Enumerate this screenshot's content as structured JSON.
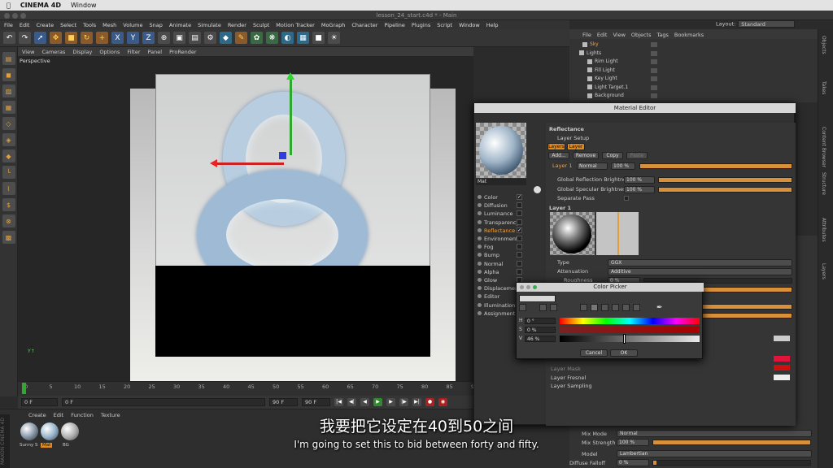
{
  "mac_menu": {
    "app": "CINEMA 4D",
    "window": "Window"
  },
  "window_title": "lesson_24_start.c4d * - Main",
  "main_menu": [
    "File",
    "Edit",
    "Create",
    "Select",
    "Tools",
    "Mesh",
    "Volume",
    "Snap",
    "Animate",
    "Simulate",
    "Render",
    "Sculpt",
    "Motion Tracker",
    "MoGraph",
    "Character",
    "Pipeline",
    "Plugins",
    "Script",
    "Window",
    "Help"
  ],
  "layout": {
    "label": "Layout:",
    "value": "Standard"
  },
  "viewport": {
    "menu": [
      "View",
      "Cameras",
      "Display",
      "Options",
      "Filter",
      "Panel",
      "ProRender"
    ],
    "label": "Perspective"
  },
  "timeline": {
    "ticks": [
      "0",
      "5",
      "10",
      "15",
      "20",
      "25",
      "30",
      "35",
      "40",
      "45",
      "50",
      "55",
      "60",
      "65",
      "70",
      "75",
      "80",
      "85",
      "90"
    ],
    "end_label": "0 F"
  },
  "frame": {
    "current": "0 F",
    "start": "0 F",
    "end": "90 F",
    "end2": "90 F"
  },
  "material_manager": {
    "menu": [
      "Create",
      "Edit",
      "Function",
      "Texture"
    ],
    "materials": [
      "Sunny S",
      "Mat",
      "BG"
    ]
  },
  "object_manager": {
    "menu": [
      "File",
      "Edit",
      "View",
      "Objects",
      "Tags",
      "Bookmarks"
    ],
    "objects": [
      "Sky",
      "Lights",
      "Rim Light",
      "Fill Light",
      "Key Light",
      "Light Target.1",
      "Background"
    ]
  },
  "right_tabs": [
    "Objects",
    "Takes",
    "Content Browser",
    "Structure",
    "Attributes",
    "Layers"
  ],
  "material_editor": {
    "title": "Material Editor",
    "mat_name": "Mat",
    "channels": [
      {
        "name": "Color",
        "checked": "✓"
      },
      {
        "name": "Diffusion",
        "checked": ""
      },
      {
        "name": "Luminance",
        "checked": ""
      },
      {
        "name": "Transparency",
        "checked": ""
      },
      {
        "name": "Reflectance",
        "checked": "✓"
      },
      {
        "name": "Environment",
        "checked": ""
      },
      {
        "name": "Fog",
        "checked": ""
      },
      {
        "name": "Bump",
        "checked": ""
      },
      {
        "name": "Normal",
        "checked": ""
      },
      {
        "name": "Alpha",
        "checked": ""
      },
      {
        "name": "Glow",
        "checked": ""
      },
      {
        "name": "Displacement",
        "checked": ""
      },
      {
        "name": "Editor",
        "checked": ""
      },
      {
        "name": "Illumination",
        "checked": ""
      },
      {
        "name": "Assignment",
        "checked": ""
      }
    ],
    "section": "Reflectance",
    "layer_setup": "Layer Setup",
    "tabs": [
      "Layers",
      "Layer 1"
    ],
    "buttons": [
      "Add...",
      "Remove",
      "Copy",
      "Paste"
    ],
    "layer_row": {
      "name": "Layer 1",
      "mode": "Normal",
      "value": "100 %"
    },
    "global_reflection": {
      "label": "Global Reflection Brightness",
      "value": "100 %"
    },
    "global_specular": {
      "label": "Global Specular Brightness",
      "value": "100 %"
    },
    "separate_pass": "Separate Pass",
    "layer_header": "Layer 1",
    "type": {
      "label": "Type",
      "value": "GGX"
    },
    "attenuation": {
      "label": "Attenuation",
      "value": "Additive"
    },
    "roughness": {
      "label": "Roughness",
      "value": "0 %"
    },
    "collapsed": [
      "Layer Mask",
      "Layer Fresnel",
      "Layer Sampling"
    ]
  },
  "color_picker": {
    "title": "Color Picker",
    "h": {
      "label": "H",
      "value": "0 °"
    },
    "s": {
      "label": "S",
      "value": "0 %"
    },
    "v": {
      "label": "V",
      "value": "46 %"
    },
    "v_fraction": 0.46,
    "cancel": "Cancel",
    "ok": "OK"
  },
  "attributes": {
    "mix_mode": {
      "label": "Mix Mode",
      "value": "Normal"
    },
    "mix_strength": {
      "label": "Mix Strength",
      "value": "100 %"
    },
    "model": {
      "label": "Model",
      "value": "Lambertian"
    },
    "diffuse_falloff": {
      "label": "Diffuse Falloff",
      "value": "0 %"
    }
  },
  "subtitles": {
    "zh": "我要把它设定在40到50之间",
    "en": "I'm going to set this to bid between forty and fifty."
  }
}
